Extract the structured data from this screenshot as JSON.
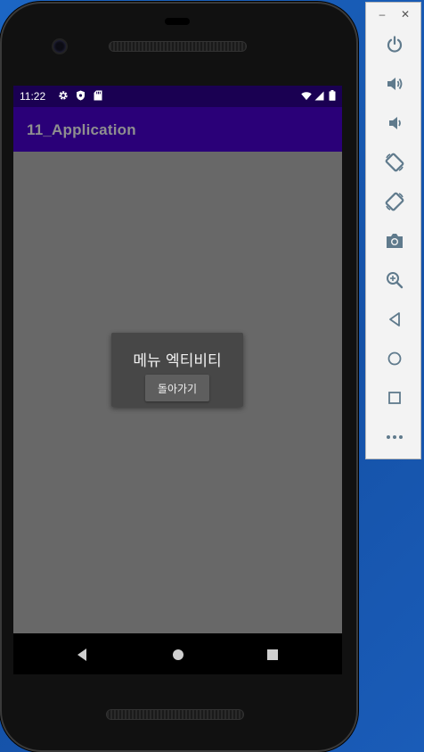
{
  "status_bar": {
    "time": "11:22",
    "left_icons": [
      "settings-gear-icon",
      "shield-icon",
      "sd-card-icon"
    ],
    "right_icons": [
      "wifi-icon",
      "cell-signal-icon",
      "battery-icon"
    ]
  },
  "app_bar": {
    "title": "11_Application"
  },
  "dialog": {
    "title": "메뉴 엑티비티",
    "button_label": "돌아가기"
  },
  "nav_bar": {
    "buttons": [
      "back-icon",
      "home-icon",
      "recents-icon"
    ]
  },
  "emulator_toolbar": {
    "window_controls": [
      "minimize-icon",
      "close-icon"
    ],
    "minimize_glyph": "–",
    "close_glyph": "✕",
    "buttons": [
      "power-icon",
      "volume-up-icon",
      "volume-down-icon",
      "rotate-left-icon",
      "rotate-right-icon",
      "camera-icon",
      "zoom-icon",
      "back-icon",
      "home-icon",
      "overview-icon",
      "more-icon"
    ]
  },
  "colors": {
    "status_bar": "#1a0052",
    "app_bar": "#2a0078",
    "app_title_text": "#8f8f8f",
    "screen_background": "#686868",
    "dialog_background": "#474747",
    "dialog_button": "#5e5e5e",
    "toolbar_icon": "#5f7a8c",
    "desktop_background": "#1a5cb8"
  }
}
